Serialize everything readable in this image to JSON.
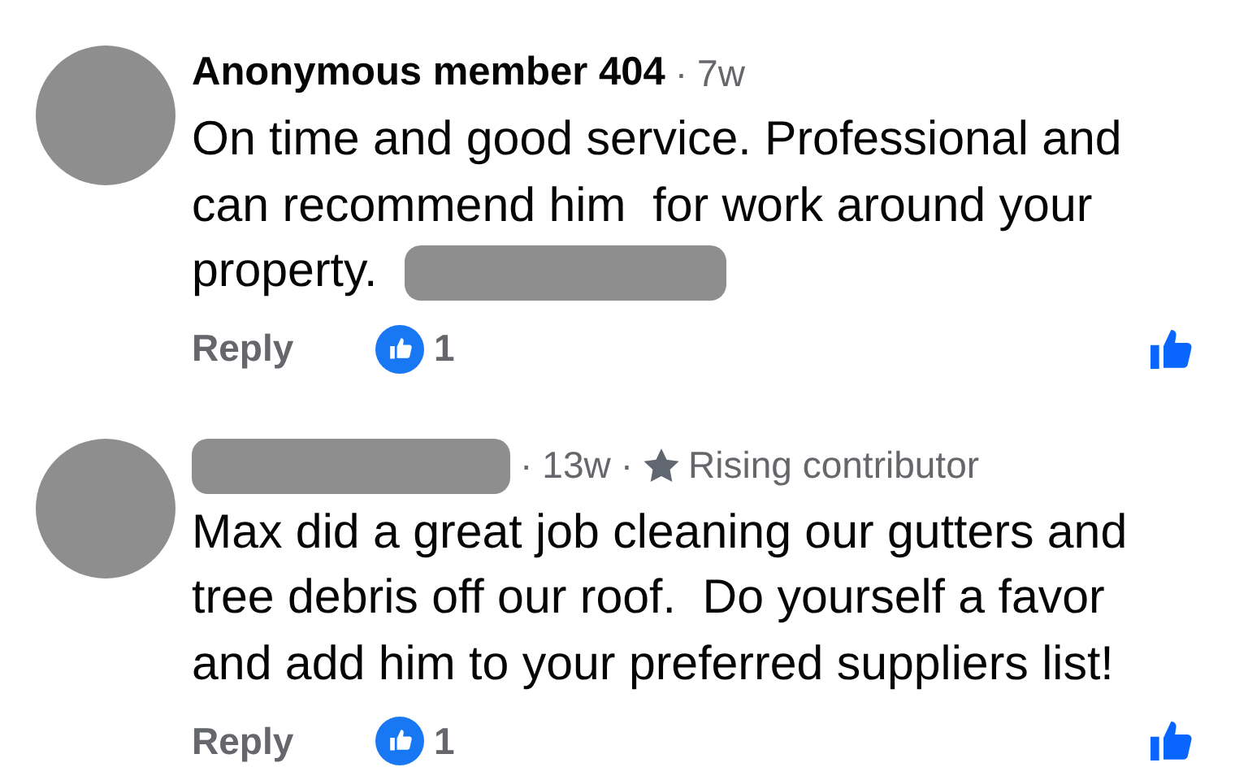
{
  "comments": [
    {
      "author": "Anonymous member 404",
      "author_redacted": false,
      "time_separator": "·",
      "time": "7w",
      "lines": [
        "On time and good service. Professional and",
        "can recommend him  for work around your",
        "property."
      ],
      "trailing_redaction": true,
      "reply_label": "Reply",
      "like_count": "1"
    },
    {
      "author_redacted": true,
      "time_separator": "·",
      "time": "13w",
      "badge_separator": "·",
      "badge": "Rising contributor",
      "lines": [
        "Max did a great job cleaning our gutters and",
        "tree debris off our roof.  Do yourself a favor",
        "and add him to your preferred suppliers list!"
      ],
      "trailing_redaction": false,
      "reply_label": "Reply",
      "like_count": "1"
    }
  ]
}
